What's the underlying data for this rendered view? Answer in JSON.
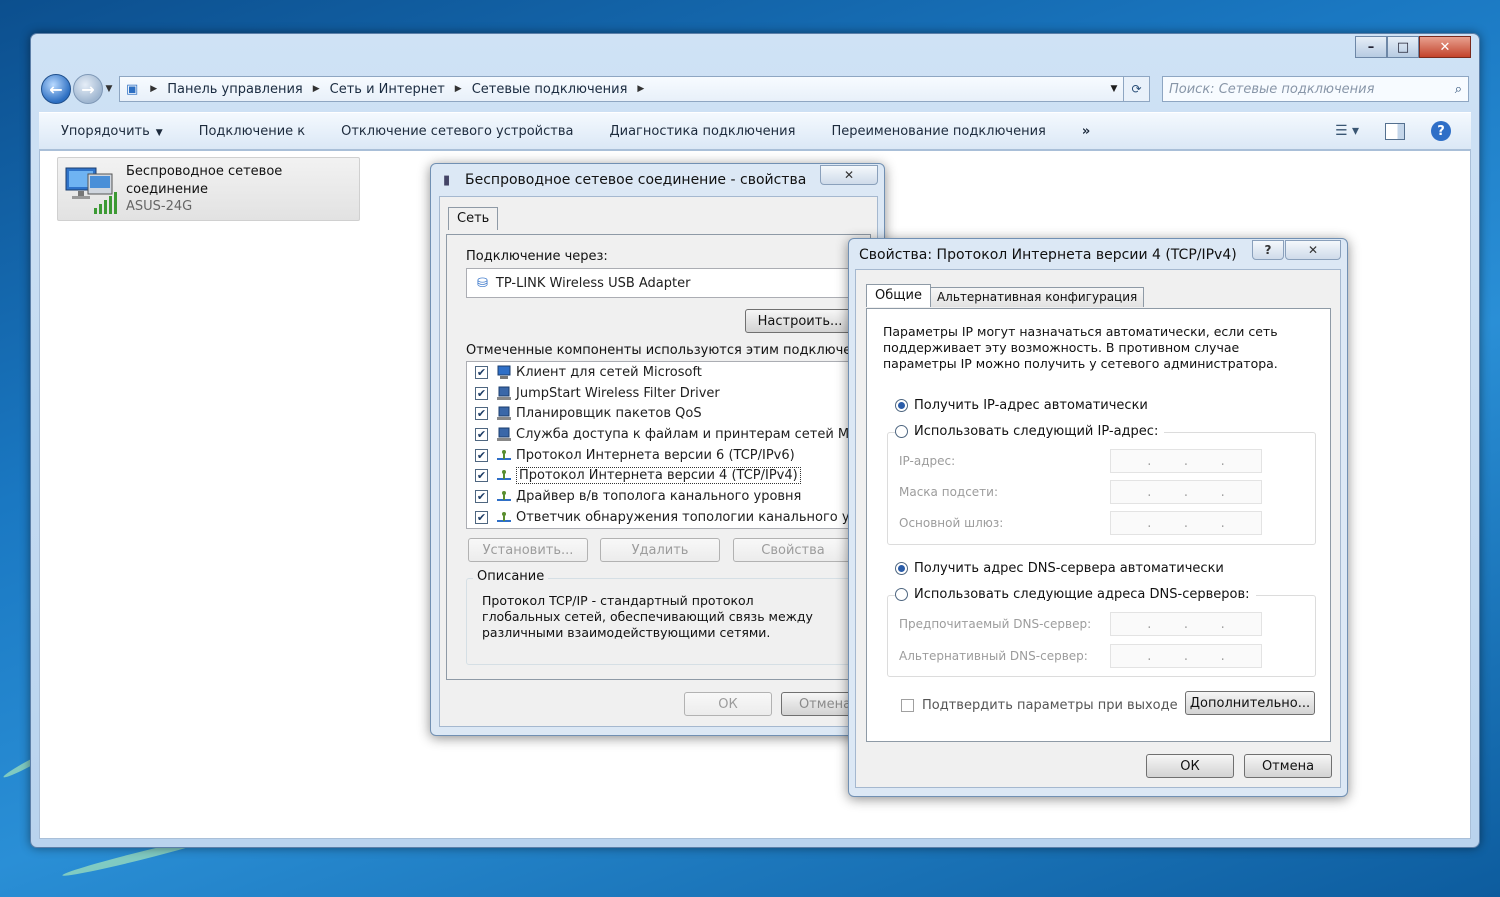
{
  "explorer": {
    "address": {
      "crumbs": [
        "Панель управления",
        "Сеть и Интернет",
        "Сетевые подключения"
      ]
    },
    "search_placeholder": "Поиск: Сетевые подключения",
    "toolbar": {
      "organize": "Упорядочить",
      "connect_to": "Подключение к",
      "disable_device": "Отключение сетевого устройства",
      "diagnose": "Диагностика подключения",
      "rename": "Переименование подключения",
      "more": "»"
    },
    "connection": {
      "name": "Беспроводное сетевое соединение",
      "ssid": "ASUS-24G"
    }
  },
  "props_dialog": {
    "title": "Беспроводное сетевое соединение - свойства",
    "tab": "Сеть",
    "connect_using_label": "Подключение через:",
    "adapter": "TP-LINK Wireless USB Adapter",
    "configure_button": "Настроить...",
    "components_label": "Отмеченные компоненты используются этим подключением:",
    "components": [
      {
        "label": "Клиент для сетей Microsoft",
        "checked": true,
        "icon": "network-client-icon"
      },
      {
        "label": "JumpStart Wireless Filter Driver",
        "checked": true,
        "icon": "network-service-icon"
      },
      {
        "label": "Планировщик пакетов QoS",
        "checked": true,
        "icon": "network-service-icon"
      },
      {
        "label": "Служба доступа к файлам и принтерам сетей Micro...",
        "checked": true,
        "icon": "network-service-icon"
      },
      {
        "label": "Протокол Интернета версии 6 (TCP/IPv6)",
        "checked": true,
        "icon": "protocol-icon"
      },
      {
        "label": "Протокол Интернета версии 4 (TCP/IPv4)",
        "checked": true,
        "icon": "protocol-icon",
        "selected": true
      },
      {
        "label": "Драйвер в/в тополога канального уровня",
        "checked": true,
        "icon": "protocol-icon"
      },
      {
        "label": "Ответчик обнаружения топологии канального уровня",
        "checked": true,
        "icon": "protocol-icon"
      }
    ],
    "install_button": "Установить...",
    "uninstall_button": "Удалить",
    "properties_button": "Свойства",
    "description_title": "Описание",
    "description_text": "Протокол TCP/IP - стандартный протокол глобальных сетей, обеспечивающий связь между различными взаимодействующими сетями.",
    "ok_button": "ОК",
    "cancel_button": "Отмена"
  },
  "ipv4_dialog": {
    "title": "Свойства: Протокол Интернета версии 4 (TCP/IPv4)",
    "help_glyph": "?",
    "tabs": [
      "Общие",
      "Альтернативная конфигурация"
    ],
    "intro": "Параметры IP могут назначаться автоматически, если сеть поддерживает эту возможность. В противном случае параметры IP можно получить у сетевого администратора.",
    "ip_auto": "Получить IP-адрес автоматически",
    "ip_manual": "Использовать следующий IP-адрес:",
    "ip_address_label": "IP-адрес:",
    "subnet_label": "Маска подсети:",
    "gateway_label": "Основной шлюз:",
    "dns_auto": "Получить адрес DNS-сервера автоматически",
    "dns_manual": "Использовать следующие адреса DNS-серверов:",
    "dns_preferred_label": "Предпочитаемый DNS-сервер:",
    "dns_alternate_label": "Альтернативный DNS-сервер:",
    "ip_dots": ".",
    "validate_label": "Подтвердить параметры при выходе",
    "advanced_button": "Дополнительно...",
    "ok_button": "ОК",
    "cancel_button": "Отмена"
  }
}
